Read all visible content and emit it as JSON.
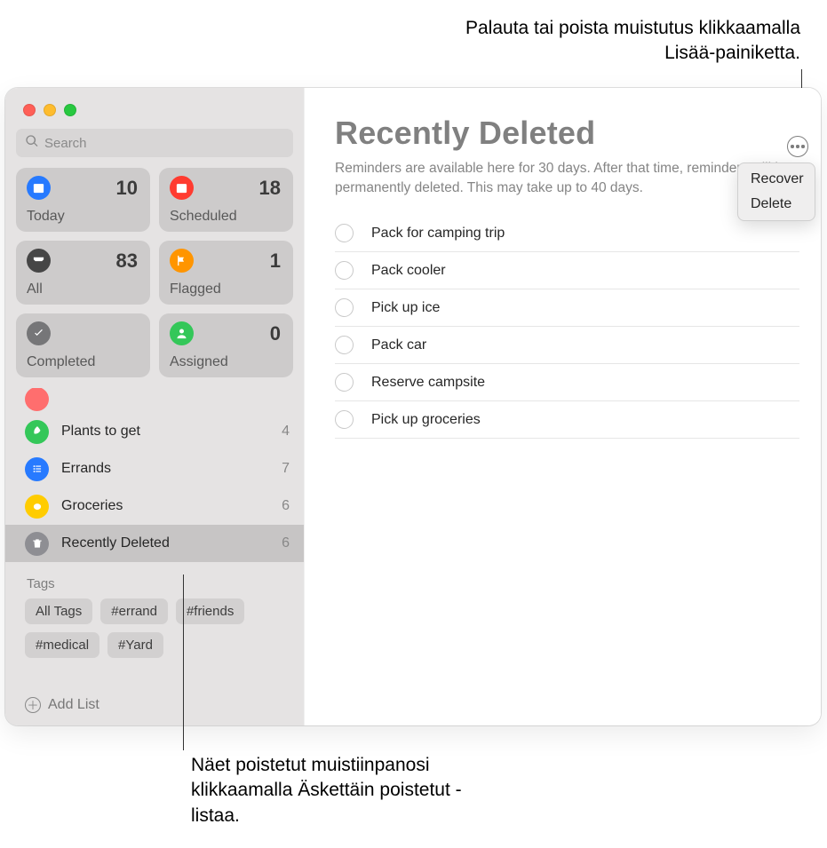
{
  "callouts": {
    "top": "Palauta tai poista muistutus klikkaamalla Lisää-painiketta.",
    "bottom": "Näet poistetut muistiinpanosi klikkaamalla Äskettäin poistetut -listaa."
  },
  "search": {
    "placeholder": "Search"
  },
  "smart": {
    "today": {
      "label": "Today",
      "count": "10"
    },
    "scheduled": {
      "label": "Scheduled",
      "count": "18"
    },
    "all": {
      "label": "All",
      "count": "83"
    },
    "flagged": {
      "label": "Flagged",
      "count": "1"
    },
    "completed": {
      "label": "Completed",
      "count": ""
    },
    "assigned": {
      "label": "Assigned",
      "count": "0"
    }
  },
  "lists": [
    {
      "name": "Plants to get",
      "count": "4"
    },
    {
      "name": "Errands",
      "count": "7"
    },
    {
      "name": "Groceries",
      "count": "6"
    },
    {
      "name": "Recently Deleted",
      "count": "6"
    }
  ],
  "tags_header": "Tags",
  "tags": [
    "All Tags",
    "#errand",
    "#friends",
    "#medical",
    "#Yard"
  ],
  "addlist": "Add List",
  "main": {
    "title": "Recently Deleted",
    "subtitle": "Reminders are available here for 30 days. After that time, reminders will be permanently deleted. This may take up to 40 days.",
    "items": [
      "Pack for camping trip",
      "Pack cooler",
      "Pick up ice",
      "Pack car",
      "Reserve campsite",
      "Pick up groceries"
    ]
  },
  "popover": {
    "recover": "Recover",
    "delete": "Delete"
  }
}
